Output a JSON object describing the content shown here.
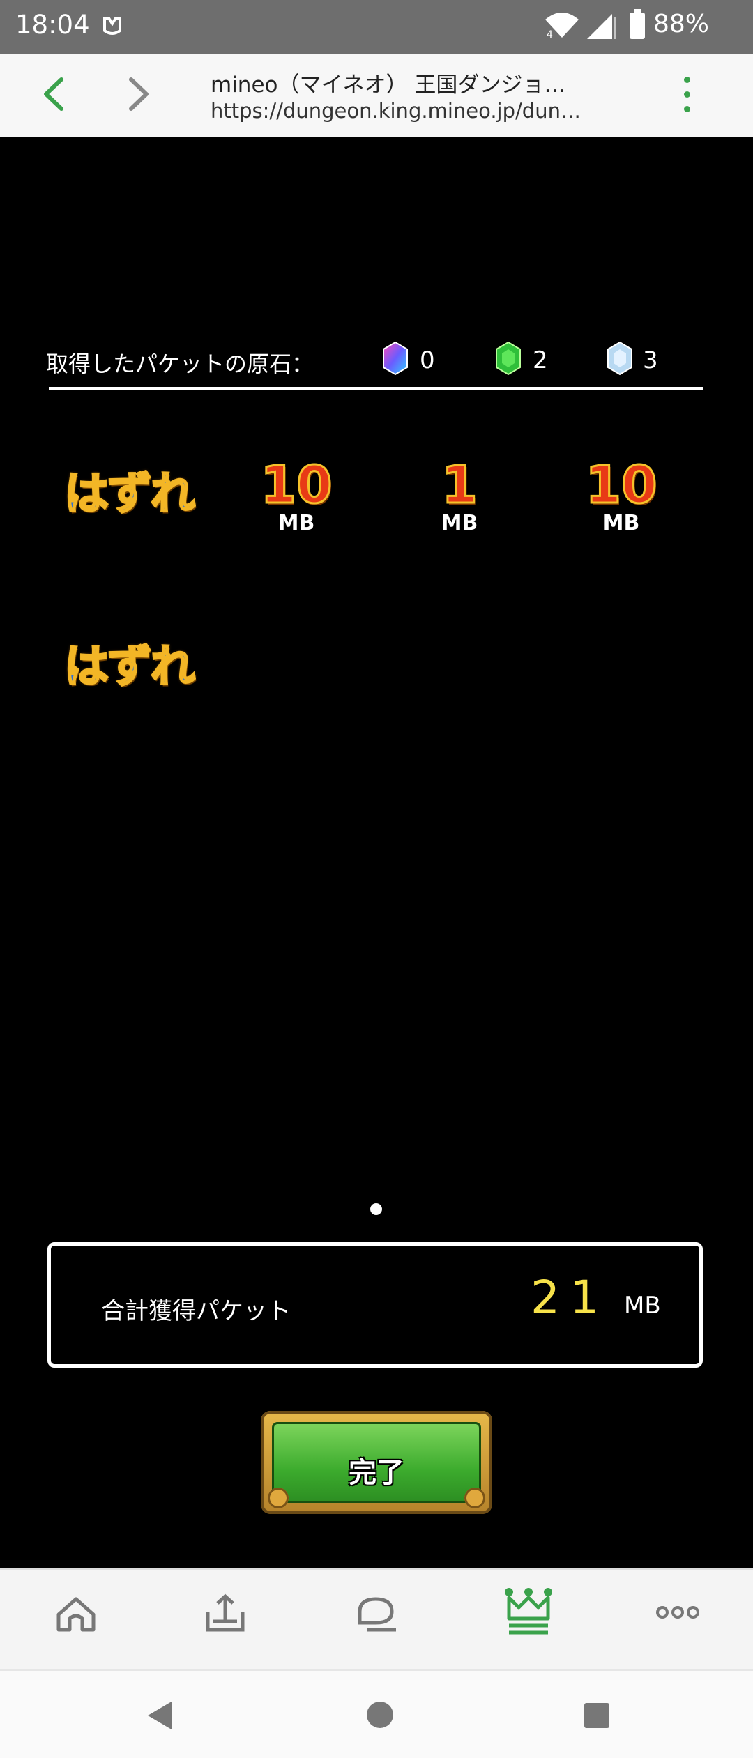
{
  "status_bar": {
    "time": "18:04",
    "battery": "88%",
    "notification_icon": "mineo-notification-icon",
    "icons": [
      "wifi-icon",
      "signal-icon",
      "battery-icon"
    ]
  },
  "browser": {
    "title": "mineo（マイネオ） 王国ダンジョ…",
    "url": "https://dungeon.king.mineo.jp/dun…",
    "icons": [
      "back-arrow-icon",
      "forward-arrow-icon",
      "overflow-menu-icon"
    ]
  },
  "gems": {
    "label": "取得したパケットの原石：",
    "items": [
      {
        "icon": "rainbow-gem-icon",
        "count": "0"
      },
      {
        "icon": "green-gem-icon",
        "count": "2"
      },
      {
        "icon": "blue-gem-icon",
        "count": "3"
      }
    ]
  },
  "results": [
    {
      "text": "はずれ"
    },
    {
      "value": "10",
      "unit": "MB"
    },
    {
      "value": "1",
      "unit": "MB"
    },
    {
      "value": "10",
      "unit": "MB"
    },
    {
      "text": "はずれ"
    }
  ],
  "total": {
    "label": "合計獲得パケット",
    "value": "21",
    "unit": "MB"
  },
  "done_button": "完了",
  "fab_icon": "grid-icon",
  "app_nav": [
    "home-icon",
    "upload-icon",
    "chat-icon",
    "crown-icon",
    "more-icon"
  ],
  "system_nav": [
    "back-icon",
    "home-circle-icon",
    "recents-icon"
  ],
  "colors": {
    "accent": "#3aa24b",
    "total_value": "#f7e24a",
    "status_bar": "#6e6e6e"
  }
}
